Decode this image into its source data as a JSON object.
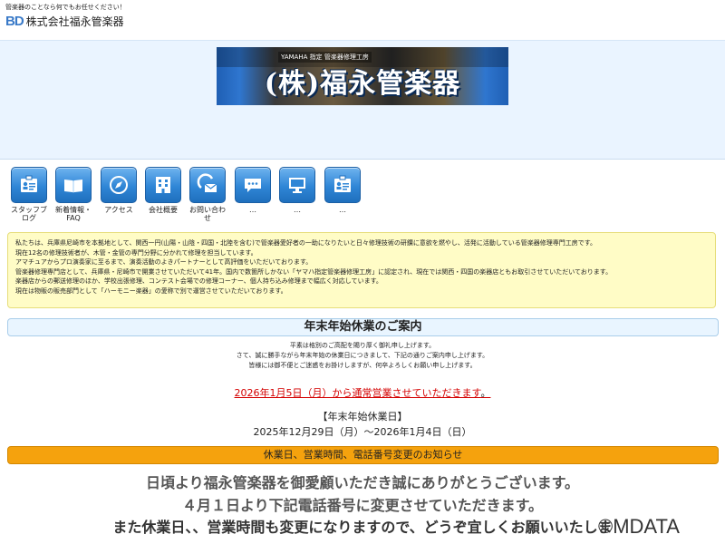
{
  "header": {
    "tagline": "管楽器のことなら何でもお任せください！",
    "logo_mark": "BD",
    "company_name": "株式会社福永管楽器"
  },
  "hero": {
    "banner_small_text": "YAMAHA 指定 管楽器修理工房",
    "banner_title": "(株)福永管楽器"
  },
  "nav": {
    "items": [
      {
        "label": "スタッフブログ",
        "icon": "staff-card-icon"
      },
      {
        "label": "新着情報・FAQ",
        "icon": "open-book-icon"
      },
      {
        "label": "アクセス",
        "icon": "compass-icon"
      },
      {
        "label": "会社概要",
        "icon": "building-icon"
      },
      {
        "label": "お問い合わせ",
        "icon": "mail-icon"
      },
      {
        "label": "…",
        "icon": "speech-bubble-icon"
      },
      {
        "label": "…",
        "icon": "monitor-icon"
      },
      {
        "label": "…",
        "icon": "id-card-icon"
      }
    ]
  },
  "intro": {
    "lines": [
      "私たちは、兵庫県尼崎市を本拠地として、関西一円(山陽・山陰・四国・北陸を含む)で管楽器愛好者の一助になりたいと日々修理技術の研鑽に意欲を燃やし、活発に活動している管楽器修理専門工房です。",
      "現在12名の修理技術者が、木管・金管の専門分野に分かれて修理を担当しています。",
      "アマチュアからプロ演奏家に至るまで、演奏活動のよきパートナーとして高評価をいただいております。",
      "管楽器修理専門店として、兵庫県・尼崎市で開業させていただいて41年。国内で数箇所しかない「ヤマハ指定管楽器修理工房」に認定され、現在では関西・四国の楽器店ともお取引させていただいております。",
      "楽器店からの郵送修理のほか、学校出張修理、コンテスト会場での修理コーナー、個人持ち込み修理まで幅広く対応しています。",
      "現在は物販の販売部門として「ハーモニー楽器」の愛称で別で運営させていただいております。"
    ]
  },
  "notice": {
    "title": "年末年始休業のご案内",
    "body": [
      "平素は格別のご高配を賜り厚く御礼申し上げます。",
      "さて、誠に勝手ながら年末年始の休業日につきまして、下記の通りご案内申し上げます。",
      "皆様には御不便とご迷惑をお掛けしますが、何卒よろしくお願い申し上げます。"
    ],
    "reopen_text": "2026年1月5日（月）から通常営業させていただきます",
    "reopen_suffix": "。",
    "holiday_title": "【年末年始休業日】",
    "holiday_dates": "2025年12月29日（月）～2026年1月4日（日）"
  },
  "change_notice": {
    "bar_label": "休業日、営業時間、電話番号変更のお知らせ",
    "line1": "日頃より福永管楽器を御愛顧いただき誠にありがとうございます。",
    "line2": "４月１日より下記電話番号に変更させていただきます。",
    "line3": "また休業日、、営業時間も変更になりますので、どうぞ宜しくお願いいたしま"
  },
  "watermark": "©MDATA",
  "colors": {
    "hero_bg": "#eaf4ff",
    "nav_icon_blue": "#2f86d6",
    "intro_bg": "#fffcc6",
    "notice_bar_bg": "#e9f5ff",
    "reopen_red": "#d40000",
    "orange_bar": "#f5a20d"
  }
}
